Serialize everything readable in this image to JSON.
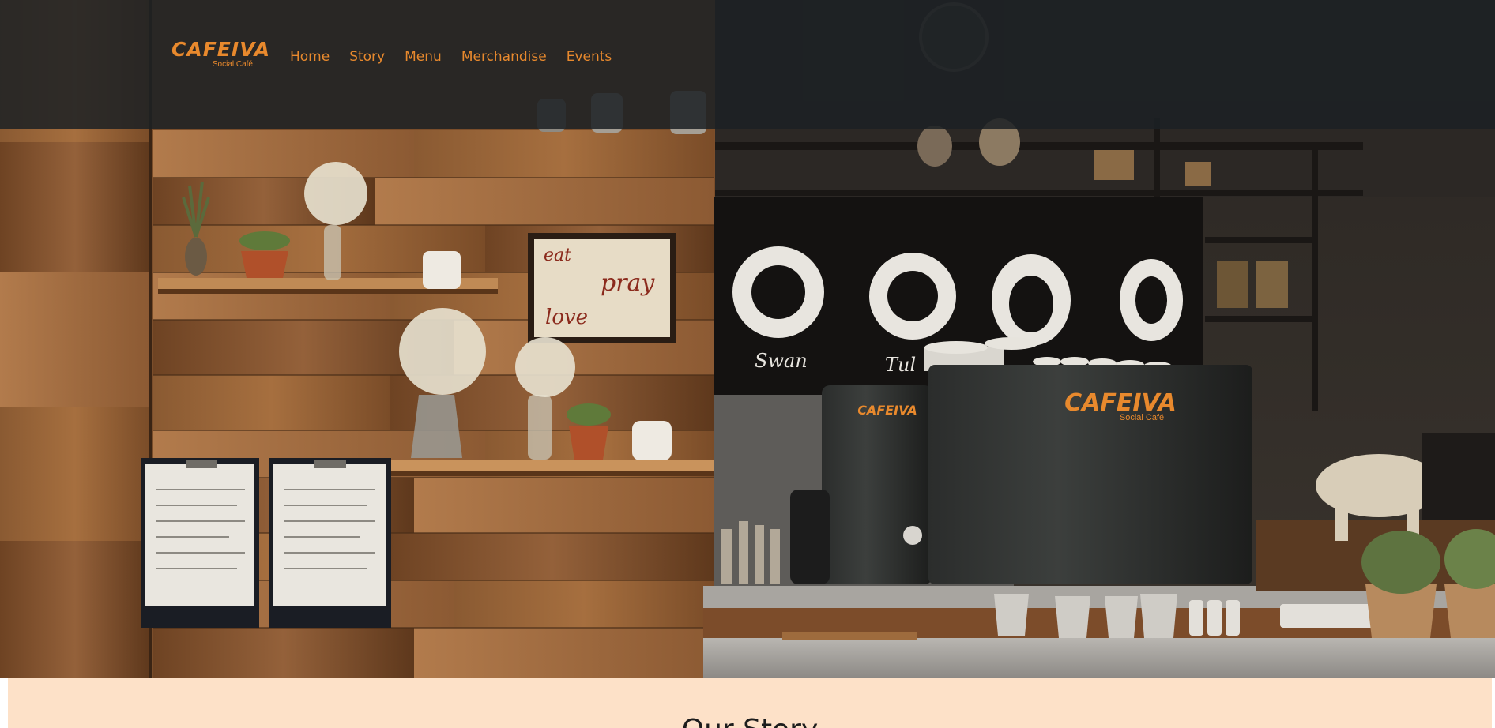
{
  "brand": {
    "name": "CAFEIVA",
    "tagline": "Social Café",
    "accent_color": "#e8892d"
  },
  "nav": {
    "items": [
      {
        "label": "Home"
      },
      {
        "label": "Story"
      },
      {
        "label": "Menu"
      },
      {
        "label": "Merchandise"
      },
      {
        "label": "Events"
      }
    ]
  },
  "hero": {
    "chalkboard_labels": [
      "Swan",
      "Tul"
    ],
    "machine_brand": "CAFEIVA",
    "machine_tagline": "Social Café",
    "sign_words": [
      "eat",
      "pray",
      "love"
    ]
  },
  "story": {
    "title": "Our Story",
    "background_color": "#fde1c8"
  }
}
